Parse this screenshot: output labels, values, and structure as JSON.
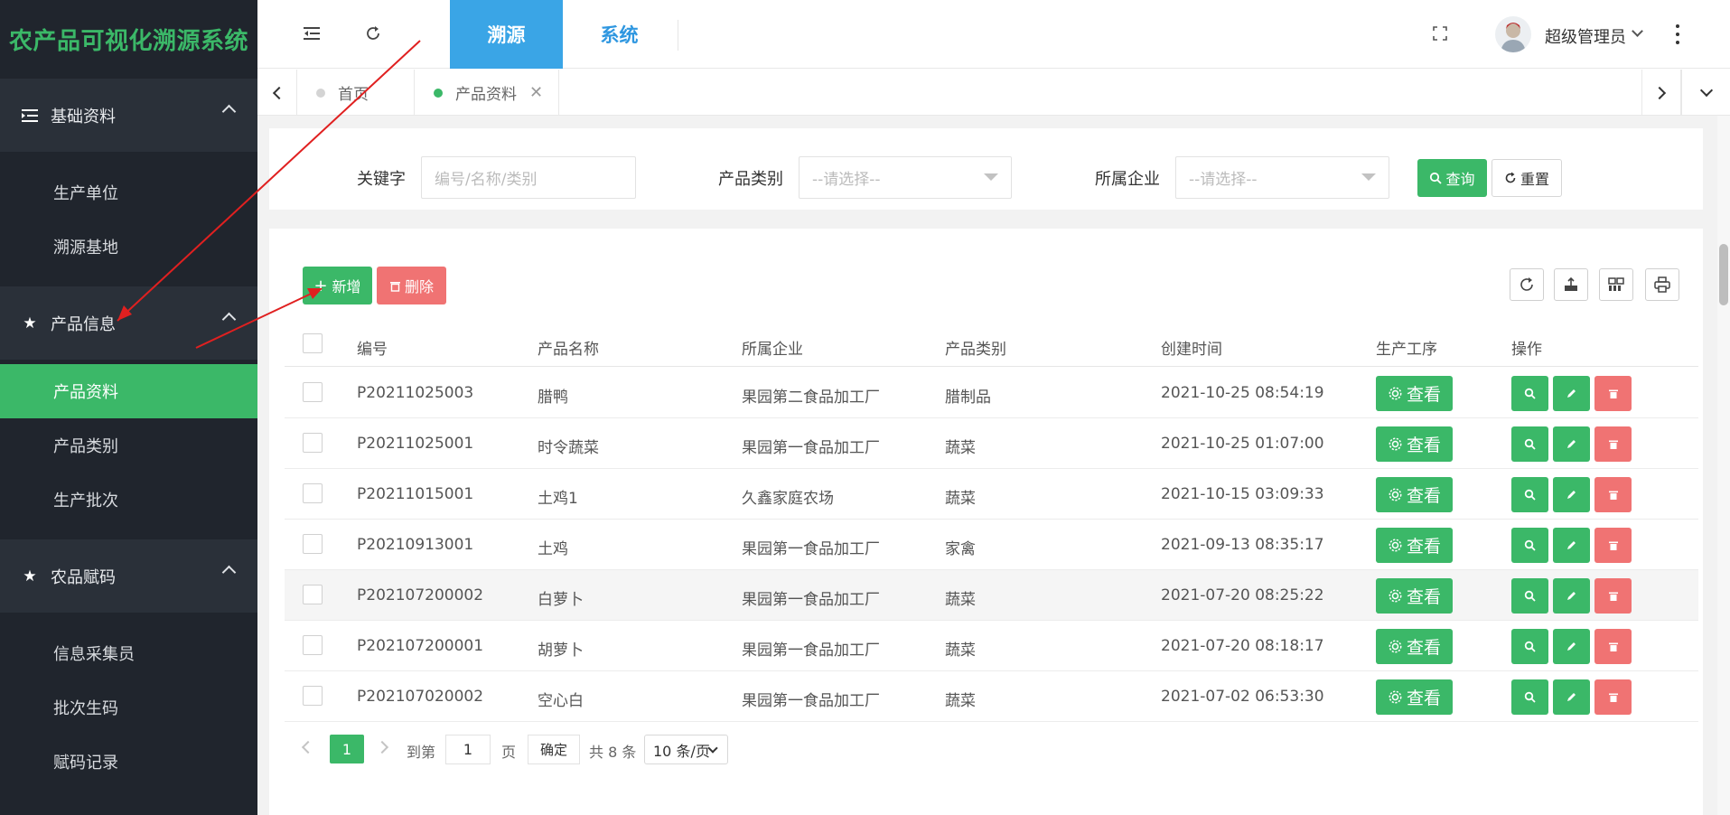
{
  "app": {
    "title": "农产品可视化溯源系统"
  },
  "colors": {
    "accent": "#3bb868",
    "danger": "#f07373",
    "topnav_active": "#3aa5e6",
    "sidebar_bg": "#20252d"
  },
  "sidebar": {
    "groups": [
      {
        "label": "基础资料",
        "icon": "list-indent-icon",
        "items": [
          "生产单位",
          "溯源基地"
        ]
      },
      {
        "label": "产品信息",
        "icon": "star-icon",
        "items": [
          "产品资料",
          "产品类别",
          "生产批次"
        ],
        "active_item": "产品资料"
      },
      {
        "label": "农品赋码",
        "icon": "star-icon",
        "items": [
          "信息采集员",
          "批次生码",
          "赋码记录"
        ]
      }
    ]
  },
  "topbar": {
    "tabs": [
      {
        "label": "溯源",
        "active": true
      },
      {
        "label": "系统",
        "active": false
      }
    ],
    "user": {
      "name": "超级管理员"
    }
  },
  "page_tabs": [
    {
      "label": "首页",
      "active": false
    },
    {
      "label": "产品资料",
      "active": true
    }
  ],
  "search": {
    "keyword_label": "关键字",
    "keyword_placeholder": "编号/名称/类别",
    "category_label": "产品类别",
    "category_placeholder": "--请选择--",
    "company_label": "所属企业",
    "company_placeholder": "--请选择--",
    "query_label": "查询",
    "reset_label": "重置"
  },
  "toolbar": {
    "add_label": "新增",
    "delete_label": "删除"
  },
  "table": {
    "columns": [
      "编号",
      "产品名称",
      "所属企业",
      "产品类别",
      "创建时间",
      "生产工序",
      "操作"
    ],
    "view_label": "查看",
    "rows": [
      {
        "code": "P20211025003",
        "name": "腊鸭",
        "company": "果园第二食品加工厂",
        "category": "腊制品",
        "created": "2021-10-25 08:54:19"
      },
      {
        "code": "P20211025001",
        "name": "时令蔬菜",
        "company": "果园第一食品加工厂",
        "category": "蔬菜",
        "created": "2021-10-25 01:07:00"
      },
      {
        "code": "P20211015001",
        "name": "土鸡1",
        "company": "久鑫家庭农场",
        "category": "蔬菜",
        "created": "2021-10-15 03:09:33"
      },
      {
        "code": "P20210913001",
        "name": "土鸡",
        "company": "果园第一食品加工厂",
        "category": "家禽",
        "created": "2021-09-13 08:35:17"
      },
      {
        "code": "P202107200002",
        "name": "白萝卜",
        "company": "果园第一食品加工厂",
        "category": "蔬菜",
        "created": "2021-07-20 08:25:22"
      },
      {
        "code": "P202107200001",
        "name": "胡萝卜",
        "company": "果园第一食品加工厂",
        "category": "蔬菜",
        "created": "2021-07-20 08:18:17"
      },
      {
        "code": "P202107020002",
        "name": "空心白",
        "company": "果园第一食品加工厂",
        "category": "蔬菜",
        "created": "2021-07-02 06:53:30"
      }
    ]
  },
  "pagination": {
    "current_page": "1",
    "goto_label": "到第",
    "goto_value": "1",
    "page_unit": "页",
    "confirm_label": "确定",
    "total_label": "共 8 条",
    "page_size": "10 条/页"
  }
}
